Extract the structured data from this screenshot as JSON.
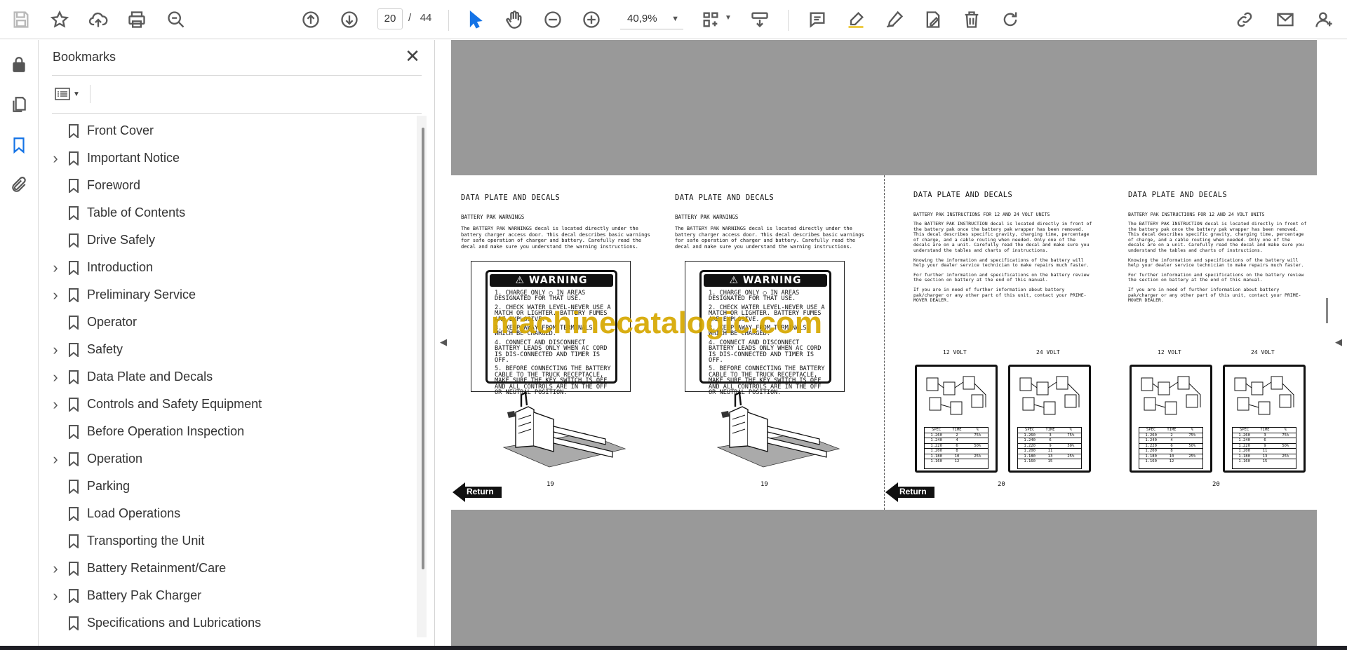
{
  "toolbar": {
    "current_page": "20",
    "page_separator": "/",
    "total_pages": "44",
    "zoom": "40,9%",
    "icons": [
      "save-icon",
      "bookmark-star-icon",
      "upload-icon",
      "print-icon",
      "find-zoom-icon",
      "previous-page-icon",
      "next-page-icon",
      "select-cursor-icon",
      "hand-tool-icon",
      "zoom-out-icon",
      "zoom-in-icon",
      "page-display-icon",
      "scroll-mode-icon",
      "comment-icon",
      "highlight-icon",
      "sign-icon",
      "fill-sign-icon",
      "delete-icon",
      "rotate-icon",
      "share-link-icon",
      "email-icon",
      "account-icon"
    ]
  },
  "rail": {
    "icons": [
      "lock-icon",
      "pages-icon",
      "bookmark-icon",
      "attachment-icon"
    ]
  },
  "bookmarks_panel": {
    "title": "Bookmarks",
    "close_glyph": "✕",
    "items": [
      {
        "label": "Front Cover",
        "expandable": false
      },
      {
        "label": "Important Notice",
        "expandable": true
      },
      {
        "label": "Foreword",
        "expandable": false
      },
      {
        "label": "Table of Contents",
        "expandable": false
      },
      {
        "label": "Drive Safely",
        "expandable": false
      },
      {
        "label": "Introduction",
        "expandable": true
      },
      {
        "label": "Preliminary Service",
        "expandable": true
      },
      {
        "label": "Operator",
        "expandable": false
      },
      {
        "label": "Safety",
        "expandable": true
      },
      {
        "label": "Data Plate and Decals",
        "expandable": true
      },
      {
        "label": "Controls and Safety Equipment",
        "expandable": true
      },
      {
        "label": "Before Operation Inspection",
        "expandable": false
      },
      {
        "label": "Operation",
        "expandable": true
      },
      {
        "label": "Parking",
        "expandable": false
      },
      {
        "label": "Load Operations",
        "expandable": false
      },
      {
        "label": "Transporting the Unit",
        "expandable": false
      },
      {
        "label": "Battery Retainment/Care",
        "expandable": true
      },
      {
        "label": "Battery Pak Charger",
        "expandable": true
      },
      {
        "label": "Specifications and Lubrications",
        "expandable": false
      }
    ]
  },
  "document": {
    "watermark": "machinecatalogic.com",
    "left_spread": {
      "title": "DATA PLATE AND DECALS",
      "subtitle": "BATTERY PAK WARNINGS",
      "body": "The BATTERY PAK WARNINGS decal is located directly under the battery charger access door. This decal describes basic warnings for safe operation of charger and battery. Carefully read the decal and make sure you understand the warning instructions.",
      "decal_heading": "⚠ WARNING",
      "decal_lines": [
        "1. CHARGE ONLY ◯ IN AREAS DESIGNATED FOR THAT USE.",
        "2. CHECK WATER LEVEL-NEVER USE A MATCH OR LIGHTER. BATTERY FUMES ARE EXPLOSIVE.",
        "3. KEEP AWAY FROM TERMINALS. WHICH BE CHARGED.",
        "4. CONNECT AND DISCONNECT BATTERY LEADS ONLY WHEN AC CORD IS DIS-CONNECTED AND TIMER IS OFF.",
        "5. BEFORE CONNECTING THE BATTERY CABLE TO THE TRUCK RECEPTACLE, MAKE SURE THE KEY SWITCH IS OFF AND ALL CONTROLS ARE IN THE OFF OR NEUTRAL POSITION."
      ],
      "page_number": "19",
      "return_label": "Return"
    },
    "right_spread": {
      "title": "DATA PLATE AND DECALS",
      "subtitle": "BATTERY PAK INSTRUCTIONS FOR 12 AND 24 VOLT UNITS",
      "body": "The BATTERY PAK INSTRUCTION decal is located directly in front of the battery pak once the battery pak wrapper has been removed. This decal describes specific gravity, charging time, percentage of charge, and a cable routing when needed. Only one of the decals are on a unit. Carefully read the decal and make sure you understand the tables and charts of instructions.",
      "body2": "Knowing the information and specifications of the battery will help your dealer service technician to make repairs much faster.",
      "body3": "For further information and specifications on the battery review the section on battery at the end of this manual.",
      "body4": "If you are in need of further information about battery pak/charger or any other part of this unit, contact your PRIME-MOVER DEALER.",
      "label_12": "12 VOLT",
      "label_24": "24 VOLT",
      "page_number": "20",
      "return_label": "Return"
    }
  },
  "colors": {
    "accent": "#1473e6",
    "page_background": "#999999",
    "watermark": "#d6a800"
  }
}
